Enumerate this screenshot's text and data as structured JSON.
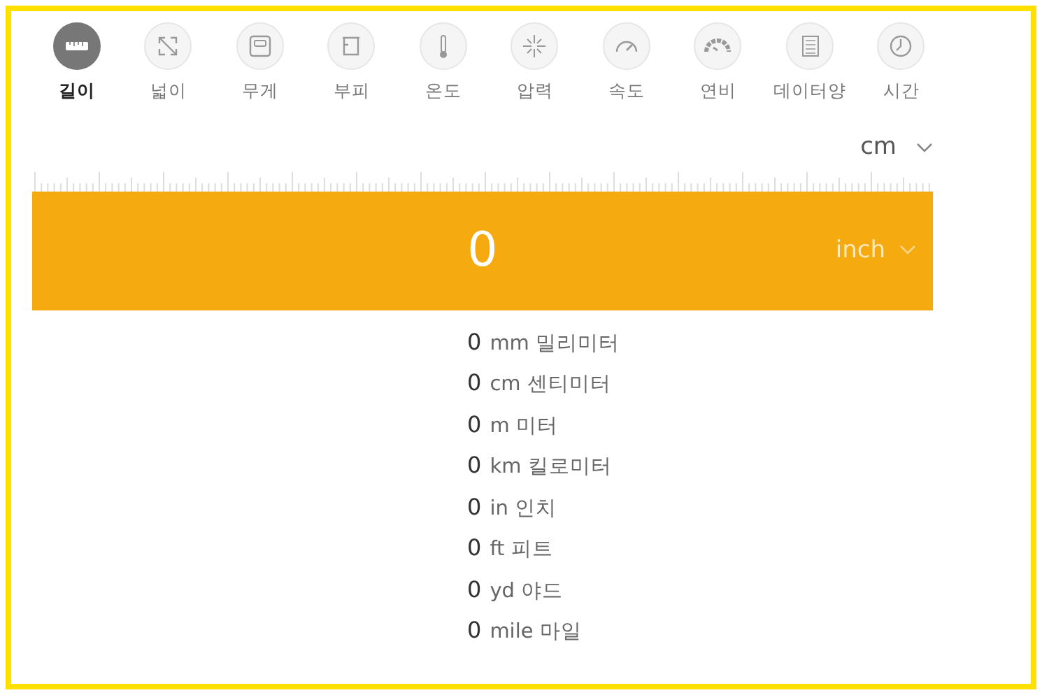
{
  "categories": [
    {
      "label": "길이",
      "selected": true
    },
    {
      "label": "넓이",
      "selected": false
    },
    {
      "label": "무게",
      "selected": false
    },
    {
      "label": "부피",
      "selected": false
    },
    {
      "label": "온도",
      "selected": false
    },
    {
      "label": "압력",
      "selected": false
    },
    {
      "label": "속도",
      "selected": false
    },
    {
      "label": "연비",
      "selected": false
    },
    {
      "label": "데이터양",
      "selected": false
    },
    {
      "label": "시간",
      "selected": false
    }
  ],
  "source_unit": "cm",
  "input": {
    "value": "0",
    "unit": "inch"
  },
  "results": [
    {
      "value": "0",
      "unit": "mm 밀리미터"
    },
    {
      "value": "0",
      "unit": "cm 센티미터"
    },
    {
      "value": "0",
      "unit": "m 미터"
    },
    {
      "value": "0",
      "unit": "km 킬로미터"
    },
    {
      "value": "0",
      "unit": "in 인치"
    },
    {
      "value": "0",
      "unit": "ft 피트"
    },
    {
      "value": "0",
      "unit": "yd 야드"
    },
    {
      "value": "0",
      "unit": "mile 마일"
    }
  ]
}
